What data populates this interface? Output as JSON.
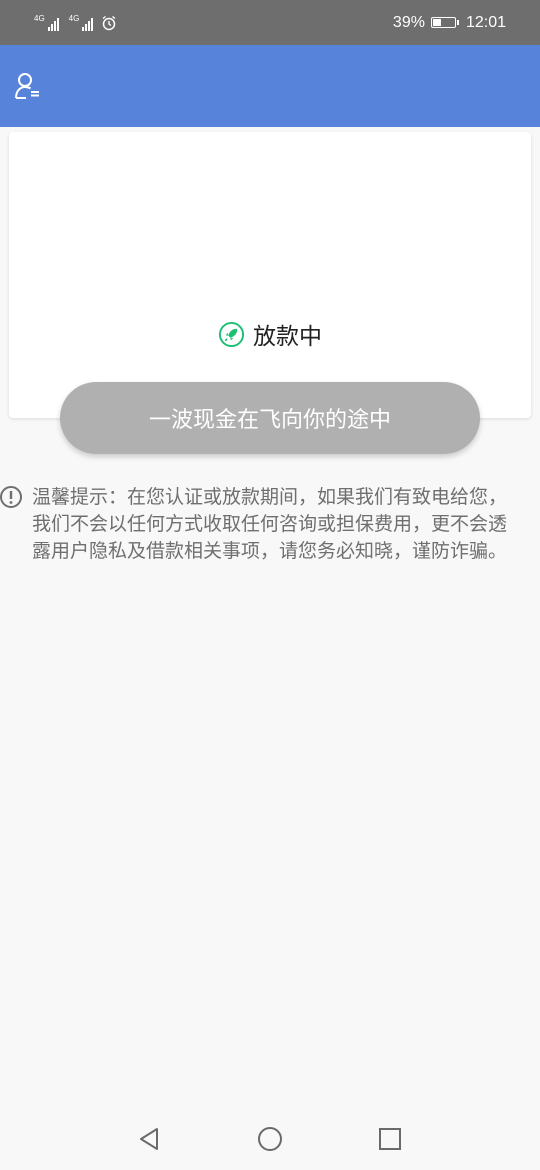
{
  "status_bar": {
    "signal_1_tag": "4G",
    "signal_2_tag": "4G",
    "battery": "39%",
    "time": "12:01"
  },
  "app_bar": {
    "profile_icon": "user-menu-icon"
  },
  "card": {
    "status_icon": "rocket-icon",
    "status_text": "放款中"
  },
  "action_button": {
    "label": "一波现金在飞向你的途中"
  },
  "notice": {
    "icon": "exclamation-circle-icon",
    "text": "温馨提示：在您认证或放款期间，如果我们有致电给您，我们不会以任何方式收取任何咨询或担保费用，更不会透露用户隐私及借款相关事项，请您务必知晓，谨防诈骗。"
  },
  "nav_bar": {
    "icons": [
      "back-icon",
      "home-icon",
      "recents-icon"
    ]
  },
  "colors": {
    "app_bar": "#5783db",
    "status_bar": "#6e6e6e",
    "button": "#b0b0b0",
    "accent_green": "#1dbf73"
  }
}
